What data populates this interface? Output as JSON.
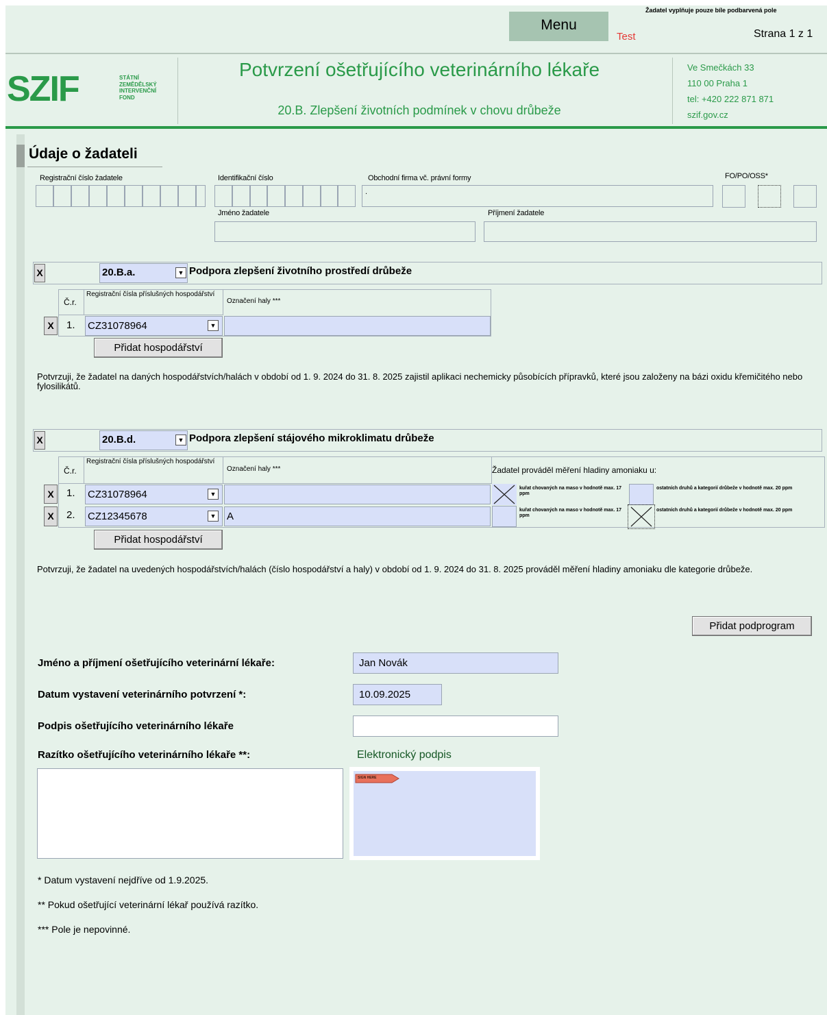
{
  "toolbar": {
    "menu_label": "Menu",
    "test_label": "Test",
    "note": "Žadatel vyplňuje pouze bíle podbarvená pole",
    "page": "Strana 1 z 1"
  },
  "header": {
    "logo_text": "SZIF",
    "logo_sub": [
      "STÁTNÍ",
      "ZEMĚDĚLSKÝ",
      "INTERVENČNÍ",
      "FOND"
    ],
    "title": "Potvrzení ošetřujícího veterinárního lékaře",
    "subtitle": "20.B. Zlepšení životních podmínek v chovu drůbeže",
    "address": [
      "Ve Smečkách 33",
      "110 00 Praha 1",
      "tel: +420 222 871 871",
      "szif.gov.cz"
    ]
  },
  "applicant": {
    "section_title": "Údaje o žadateli",
    "reg_label": "Registrační číslo žadatele",
    "ic_label": "Identifikační číslo",
    "firm_label": "Obchodní firma vč. právní formy",
    "fopo_label": "FO/PO/OSS*",
    "firm_value": ".",
    "name_label": "Jméno žadatele",
    "surname_label": "Příjmení žadatele"
  },
  "sub_a": {
    "x": "X",
    "code": "20.B.a.",
    "dropdown_icon": "▼",
    "title": "Podpora zlepšení životního prostředí drůbeže",
    "col_cr": "Č.r.",
    "col_reg": "Registrační čísla příslušných hospodářství",
    "col_hala": "Označení haly ***",
    "rows": [
      {
        "x": "X",
        "cr": "1.",
        "reg": "CZ31078964",
        "hala": ""
      }
    ],
    "add_button": "Přidat hospodářství",
    "statement": "Potvrzuji, že žadatel na daných hospodářstvích/halách v období od 1. 9. 2024 do 31. 8. 2025 zajistil aplikaci nechemicky působících přípravků, které jsou založeny na bázi oxidu křemičitého nebo fylosilikátů."
  },
  "sub_d": {
    "x": "X",
    "code": "20.B.d.",
    "title": "Podpora zlepšení stájového mikroklimatu drůbeže",
    "col_cr": "Č.r.",
    "col_reg": "Registrační čísla příslušných hospodářství",
    "col_hala": "Označení haly ***",
    "col_mereni": "Žadatel prováděl měření hladiny amoniaku u:",
    "opt1": "kuřat chovaných na maso v hodnotě max. 17 ppm",
    "opt2": "ostatních druhů a kategorií drůbeže v hodnotě max. 20 ppm",
    "rows": [
      {
        "x": "X",
        "cr": "1.",
        "reg": "CZ31078964",
        "hala": ""
      },
      {
        "x": "X",
        "cr": "2.",
        "reg": "CZ12345678",
        "hala": "A"
      }
    ],
    "add_button": "Přidat hospodářství",
    "statement": "Potvrzuji, že žadatel na uvedených hospodářstvích/halách (číslo hospodářství a haly) v období od 1. 9. 2024 do 31. 8. 2025 prováděl měření hladiny amoniaku dle kategorie drůbeže."
  },
  "add_subprogram": "Přidat podprogram",
  "vet": {
    "name_label": "Jméno a příjmení ošetřujícího veterinární lékaře:",
    "name_value": "Jan Novák",
    "date_label": "Datum vystavení veterinárního potvrzení *:",
    "date_value": "10.09.2025",
    "sign_label": "Podpis ošetřujícího veterinárního lékaře",
    "stamp_label": "Razítko ošetřujícího veterinárního lékaře **:",
    "esign_label": "Elektronický podpis",
    "esign_tag": "SIGN HERE"
  },
  "footnotes": [
    "* Datum vystavení nejdříve od 1.9.2025.",
    "** Pokud ošetřující veterinární lékař používá razítko.",
    "*** Pole je nepovinné."
  ],
  "colors": {
    "accent_green": "#2a9a49",
    "field_blue": "#d8e0f9",
    "test_red": "#e53935"
  }
}
